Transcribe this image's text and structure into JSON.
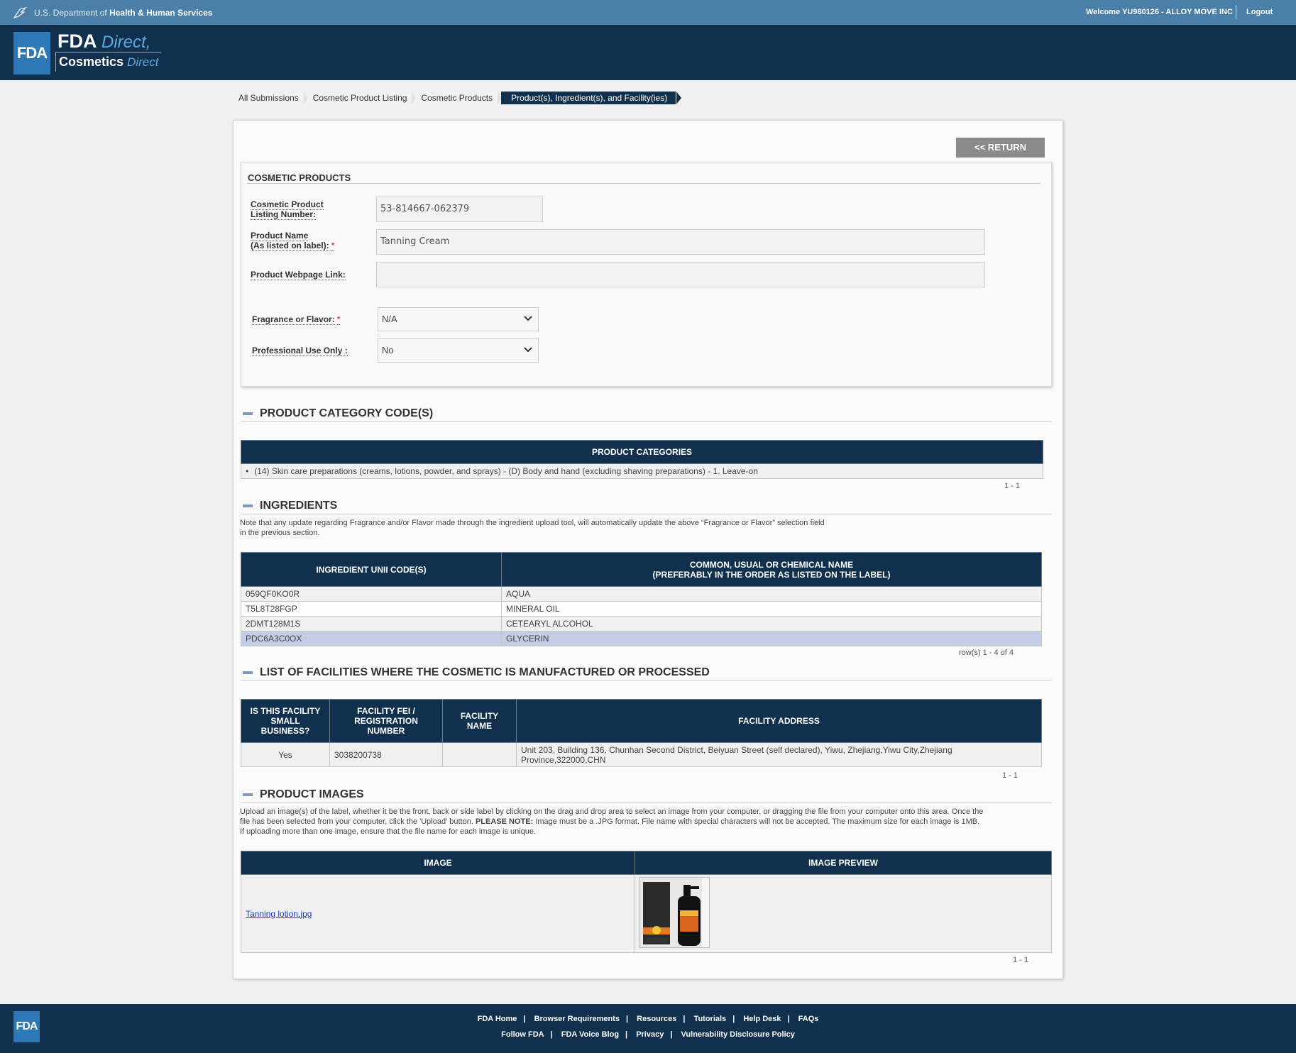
{
  "topbar": {
    "dept_prefix": "U.S. Department of",
    "dept_name": "Health & Human Services",
    "welcome": "Welcome YU980126 - ALLOY MOVE INC",
    "logout": "Logout"
  },
  "header": {
    "fda": "FDA",
    "direct": "Direct",
    "cosmetics": "Cosmetics",
    "cosmetics_direct": "Direct"
  },
  "breadcrumb": [
    "All Submissions",
    "Cosmetic Product Listing",
    "Cosmetic Products",
    "Product(s), Ingredient(s), and Facility(ies)"
  ],
  "return_label": "<< RETURN",
  "cosmetic_products": {
    "title": "COSMETIC PRODUCTS",
    "listing_label_1": "Cosmetic Product",
    "listing_label_2": "Listing Number:",
    "listing_value": "53-814667-062379",
    "name_label_1": "Product Name",
    "name_label_2": "(As listed on label):",
    "name_value": "Tanning Cream",
    "webpage_label": "Product Webpage Link:",
    "webpage_value": "",
    "fragrance_label": "Fragrance or Flavor:",
    "fragrance_value": "N/A",
    "professional_label": "Professional Use Only :",
    "professional_value": "No",
    "required_mark": "*"
  },
  "category": {
    "title": "PRODUCT CATEGORY CODE(S)",
    "header": "PRODUCT CATEGORIES",
    "item": "(14) Skin care preparations (creams, lotions, powder, and sprays) - (D) Body and hand (excluding shaving preparations) - 1. Leave-on",
    "pager": "1 - 1"
  },
  "ingredients": {
    "title": "INGREDIENTS",
    "note_1": "Note that any update regarding Fragrance and/or Flavor made through the ingredient upload tool, will automatically update the above “Fragrance or Flavor” selection field",
    "note_2": "in the previous section.",
    "col1": "INGREDIENT UNII CODE(S)",
    "col2_1": "COMMON, USUAL OR CHEMICAL NAME",
    "col2_2": "(PREFERABLY IN THE ORDER AS LISTED ON THE LABEL)",
    "rows": [
      {
        "code": "059QF0KO0R",
        "name": "AQUA"
      },
      {
        "code": "T5L8T28FGP",
        "name": "MINERAL OIL"
      },
      {
        "code": "2DMT128M1S",
        "name": "CETEARYL ALCOHOL"
      },
      {
        "code": "PDC6A3C0OX",
        "name": "GLYCERIN"
      }
    ],
    "pager": "row(s) 1 - 4 of 4"
  },
  "facilities": {
    "title": "LIST OF FACILITIES WHERE THE COSMETIC IS MANUFACTURED OR PROCESSED",
    "col1_1": "IS THIS FACILITY",
    "col1_2": "SMALL",
    "col1_3": "BUSINESS?",
    "col2_1": "FACILITY FEI /",
    "col2_2": "REGISTRATION",
    "col2_3": "NUMBER",
    "col3_1": "FACILITY",
    "col3_2": "NAME",
    "col4": "FACILITY ADDRESS",
    "small_business": "Yes",
    "fei": "3038200738",
    "name": "",
    "address_1": "Unit 203, Building 136, Chunhan Second District, Beiyuan Street (self declared), Yiwu, Zhejiang,Yiwu City,Zhejiang",
    "address_2": "Province,322000,CHN",
    "pager": "1 - 1"
  },
  "images": {
    "title": "PRODUCT IMAGES",
    "note_1": "Upload an image(s) of the label, whether it be the front, back or side label by clicking on the drag and drop area to select an image from your computer, or dragging the file from your computer onto this area. Once the",
    "note_2a": "file has been selected from your computer, click the 'Upload' button.",
    "note_2b": "PLEASE NOTE:",
    "note_2c": "Image must be a .JPG format. File name with special characters will not be accepted. The maximum size for each image is 1MB.",
    "note_3": "If uploading more than one image, ensure that the file name for each image is unique.",
    "col1": "IMAGE",
    "col2": "IMAGE PREVIEW",
    "file": "Tanning lotion.jpg",
    "pager": "1 - 1"
  },
  "footer": {
    "logo": "FDA",
    "row1": [
      "FDA Home",
      "Browser Requirements",
      "Resources",
      "Tutorials",
      "Help Desk",
      "FAQs"
    ],
    "row2": [
      "Follow FDA",
      "FDA Voice Blog",
      "Privacy",
      "Vulnerability Disclosure Policy"
    ],
    "sep": "|"
  },
  "colors": {
    "navy": "#10304d",
    "hhs_blue": "#4a7fa8",
    "fda_blue": "#2e78b6",
    "selected_row": "#c5cde5"
  }
}
